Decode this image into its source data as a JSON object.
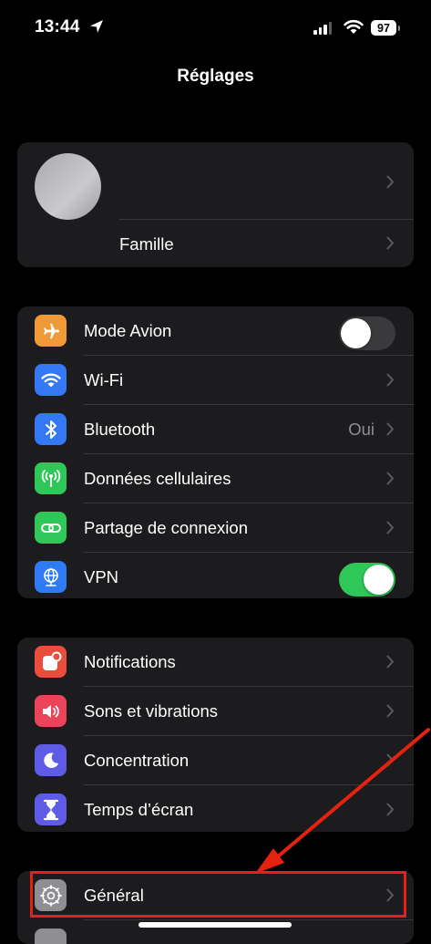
{
  "status_bar": {
    "time": "13:44",
    "battery": "97"
  },
  "header": {
    "title": "Réglages"
  },
  "profile": {
    "family_label": "Famille"
  },
  "connectivity": {
    "airplane_label": "Mode Avion",
    "airplane_on": false,
    "wifi_label": "Wi-Fi",
    "bluetooth_label": "Bluetooth",
    "bluetooth_value": "Oui",
    "cellular_label": "Données cellulaires",
    "hotspot_label": "Partage de connexion",
    "vpn_label": "VPN",
    "vpn_on": true
  },
  "attention": {
    "notifications_label": "Notifications",
    "sounds_label": "Sons et vibrations",
    "focus_label": "Concentration",
    "screentime_label": "Temps d’écran"
  },
  "general": {
    "general_label": "Général"
  },
  "colors": {
    "airplane": "#f09a37",
    "wifi": "#3478f6",
    "bluetooth": "#3478f6",
    "cellular": "#30c759",
    "hotspot": "#30c759",
    "vpn": "#2f7bf5",
    "notifications": "#eb4d3d",
    "sounds": "#eb445a",
    "focus": "#5e5ce6",
    "screentime": "#5e5ce6",
    "general": "#8e8e93",
    "annotation": "#e5220f"
  }
}
